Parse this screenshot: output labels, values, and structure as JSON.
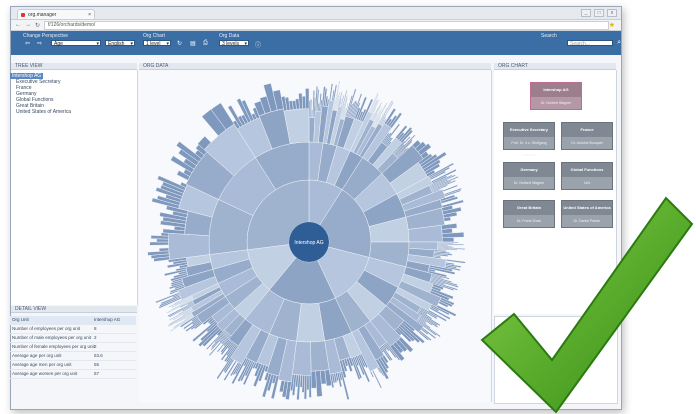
{
  "browser": {
    "tab_title": "org.manager",
    "url": "f/126/orchards/demo/",
    "window_buttons": [
      "_",
      "□",
      "x"
    ]
  },
  "toolbar": {
    "perspective_label": "Change Perspective",
    "perspective_value": "Age",
    "language_value": "English",
    "orgchart_label": "Org Chart",
    "orgchart_value": "1 level",
    "orgdata_label": "Org Data",
    "orgdata_value": "3 levels",
    "search_label": "Search",
    "search_placeholder": "Search..."
  },
  "tree": {
    "header": "TREE VIEW",
    "root": "Intershop AG",
    "items": [
      "Executive Secretary",
      "France",
      "Germany",
      "Global Functions",
      "Great Britain",
      "United States of America"
    ]
  },
  "main": {
    "header": "ORG DATA",
    "center_label": "Intershop AG"
  },
  "orgchart": {
    "header": "ORG CHART",
    "root": {
      "title": "Intershop AG",
      "person": "Dr. Norbert Wagner"
    },
    "nodes": [
      {
        "title": "Executive Secretary",
        "person": "Prof. Dr. h.c. Wolfgang Hartmann"
      },
      {
        "title": "France",
        "person": "Dr. Antoine Bouquet"
      },
      {
        "title": "Germany",
        "person": "Dr. Norbert Wagner"
      },
      {
        "title": "Global Functions",
        "person": "N/A"
      },
      {
        "title": "Great Britain",
        "person": "Dr. Frank Shaw"
      },
      {
        "title": "United States of America",
        "person": "Dr. Daniel Parker"
      }
    ]
  },
  "detail": {
    "header": "DETAIL VIEW",
    "rows": [
      {
        "label": "Org Unit",
        "value": "Intershop AG"
      },
      {
        "label": "Number of employees per org unit",
        "value": "8"
      },
      {
        "label": "Number of male employees per org unit",
        "value": "2"
      },
      {
        "label": "Number of female employees per org unit",
        "value": "2"
      },
      {
        "label": "Average age per org unit",
        "value": "53.6"
      },
      {
        "label": "Average age men per org unit",
        "value": "55"
      },
      {
        "label": "Average age women per org unit",
        "value": "57"
      }
    ]
  },
  "colors": {
    "toolbar": "#3a6ea5",
    "sunburst_center": "#2f5e97",
    "checkmark": "#4aa21e"
  }
}
